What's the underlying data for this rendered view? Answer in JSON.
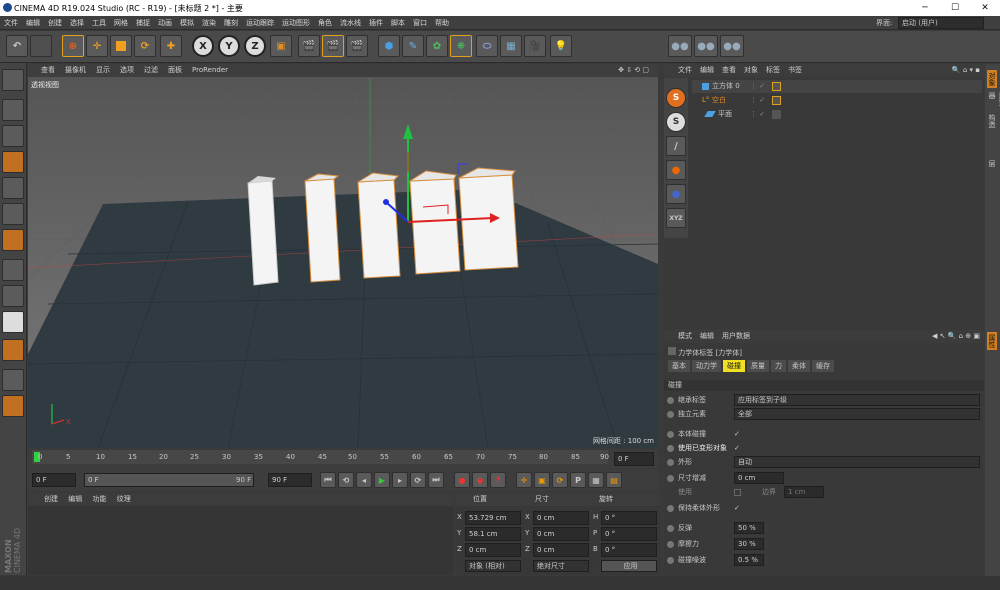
{
  "window": {
    "title": "CINEMA 4D R19.024 Studio (RC - R19) - [未标题 2 *] - 主要",
    "minimize": "─",
    "maximize": "☐",
    "close": "✕"
  },
  "menu": [
    "文件",
    "编辑",
    "创建",
    "选择",
    "工具",
    "网格",
    "捕捉",
    "动画",
    "模拟",
    "渲染",
    "雕刻",
    "运动跟踪",
    "运动图形",
    "角色",
    "流水线",
    "插件",
    "脚本",
    "窗口",
    "帮助"
  ],
  "layout": {
    "label": "界面:",
    "value": "启动 (用户)"
  },
  "toolbar": {
    "x": "X",
    "y": "Y",
    "z": "Z"
  },
  "viewport": {
    "menu": [
      "查看",
      "摄像机",
      "显示",
      "选项",
      "过滤",
      "面板",
      "ProRender"
    ],
    "label": "透视视图",
    "grid_spacing": "网格间距 : 100 cm"
  },
  "timeline": {
    "ticks": [
      "0",
      "5",
      "10",
      "15",
      "20",
      "25",
      "30",
      "35",
      "40",
      "45",
      "50",
      "55",
      "60",
      "65",
      "70",
      "75",
      "80",
      "85",
      "90"
    ],
    "end_frame": "0 F"
  },
  "transport": {
    "start": "0 F",
    "cur": "0 F",
    "end_a": "90 F",
    "end_b": "90 F"
  },
  "materials": {
    "tabs": [
      "创建",
      "编辑",
      "功能",
      "纹理"
    ]
  },
  "coords": {
    "headers": [
      "位置",
      "尺寸",
      "旋转"
    ],
    "rows": [
      {
        "axis": "X",
        "pos": "53.729 cm",
        "size_axis": "X",
        "size": "0 cm",
        "rot_axis": "H",
        "rot": "0 °"
      },
      {
        "axis": "Y",
        "pos": "58.1 cm",
        "size_axis": "Y",
        "size": "0 cm",
        "rot_axis": "P",
        "rot": "0 °"
      },
      {
        "axis": "Z",
        "pos": "0 cm",
        "size_axis": "Z",
        "size": "0 cm",
        "rot_axis": "B",
        "rot": "0 °"
      }
    ],
    "mode": "对象 (相对)",
    "size_mode": "绝对尺寸",
    "apply": "应用"
  },
  "objects": {
    "menu": [
      "文件",
      "编辑",
      "查看",
      "对象",
      "标签",
      "书签"
    ],
    "items": [
      {
        "name": "立方体 0",
        "indent": 0
      },
      {
        "name": "空白",
        "indent": 0
      },
      {
        "name": "平面",
        "indent": 1
      }
    ]
  },
  "attributes": {
    "menu": [
      "模式",
      "编辑",
      "用户数据"
    ],
    "tag_title": "力学体标签 [力学体]",
    "tabs": [
      "基本",
      "动力学",
      "碰撞",
      "质量",
      "力",
      "柔体",
      "缓存"
    ],
    "active_tab": "碰撞",
    "section": "碰撞",
    "rows": [
      {
        "label": "继承标签",
        "value": "应用标签到子级",
        "type": "select"
      },
      {
        "label": "独立元素",
        "value": "全部",
        "type": "select"
      },
      {
        "label": "本体碰撞",
        "value": "✓",
        "type": "check"
      },
      {
        "label": "使用已变形对象",
        "value": "✓",
        "type": "check"
      },
      {
        "label": "外形",
        "value": "自动",
        "type": "select"
      },
      {
        "label": "尺寸增减",
        "value": "0 cm",
        "type": "num"
      },
      {
        "label": "使用",
        "value": "",
        "type": "check2"
      },
      {
        "label": "保持柔体外形",
        "value": "✓",
        "type": "check"
      },
      {
        "label": "反弹",
        "value": "50 %",
        "type": "num"
      },
      {
        "label": "摩擦力",
        "value": "30 %",
        "type": "num"
      },
      {
        "label": "碰撞噪波",
        "value": "0.5 %",
        "type": "num"
      }
    ],
    "edge_label": "边界",
    "edge_value": "1 cm"
  },
  "brand": {
    "line1": "MAXON",
    "line2": "CINEMA 4D"
  },
  "right_tabs": [
    "对象",
    "内容浏览器",
    "构造",
    "层"
  ],
  "attr_tab": "属性"
}
